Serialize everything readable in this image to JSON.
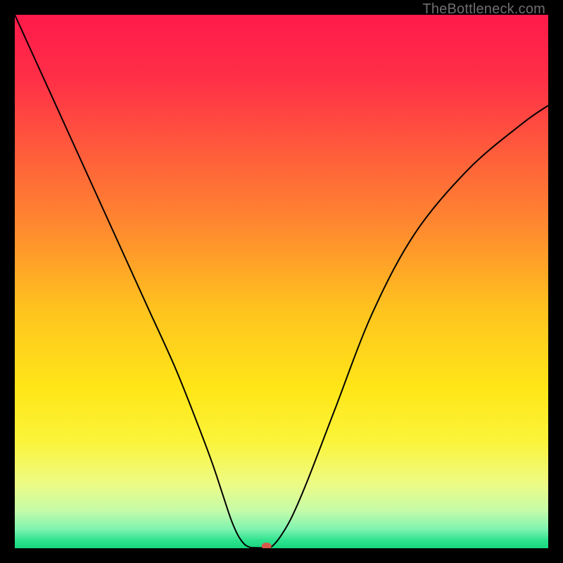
{
  "watermark": "TheBottleneck.com",
  "chart_data": {
    "type": "line",
    "title": "",
    "xlabel": "",
    "ylabel": "",
    "xlim": [
      0,
      100
    ],
    "ylim": [
      0,
      100
    ],
    "background": {
      "type": "vertical-gradient",
      "stops": [
        {
          "pos": 0.0,
          "color": "#ff1a4b"
        },
        {
          "pos": 0.12,
          "color": "#ff2f47"
        },
        {
          "pos": 0.25,
          "color": "#ff5a3c"
        },
        {
          "pos": 0.4,
          "color": "#ff8a2f"
        },
        {
          "pos": 0.55,
          "color": "#ffc21f"
        },
        {
          "pos": 0.7,
          "color": "#ffe618"
        },
        {
          "pos": 0.8,
          "color": "#fbf43a"
        },
        {
          "pos": 0.88,
          "color": "#edfb85"
        },
        {
          "pos": 0.93,
          "color": "#c5fba9"
        },
        {
          "pos": 0.965,
          "color": "#7df3b0"
        },
        {
          "pos": 0.985,
          "color": "#2fe38e"
        },
        {
          "pos": 1.0,
          "color": "#17d67f"
        }
      ]
    },
    "series": [
      {
        "name": "curve",
        "color": "#000000",
        "width": 2,
        "x": [
          0,
          5,
          10,
          15,
          20,
          25,
          30,
          34,
          37,
          39,
          40.5,
          41.8,
          43,
          44,
          44.7,
          47.5,
          48.5,
          50,
          52,
          55,
          60,
          67,
          75,
          85,
          95,
          100
        ],
        "y": [
          100,
          89,
          78,
          67,
          56,
          45,
          34,
          24,
          16,
          10,
          5.5,
          2.5,
          0.8,
          0.2,
          0.1,
          0.1,
          0.6,
          2.5,
          6,
          13,
          26,
          44,
          59,
          71,
          79.5,
          83
        ]
      }
    ],
    "marker": {
      "name": "optimal-point",
      "x": 47.2,
      "y": 0.4,
      "color": "#d65a4a",
      "rx": 7,
      "ry": 5
    }
  }
}
